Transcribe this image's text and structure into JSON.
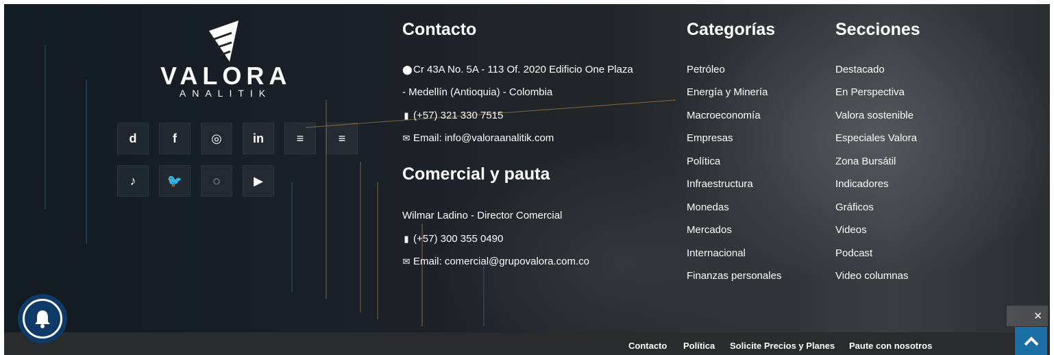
{
  "brand": {
    "name": "VALORA",
    "sub": "ANALITIK"
  },
  "social": [
    {
      "icon": "dailymotion-icon",
      "glyph": "d"
    },
    {
      "icon": "facebook-icon",
      "glyph": "f"
    },
    {
      "icon": "instagram-icon",
      "glyph": "◎"
    },
    {
      "icon": "linkedin-icon",
      "glyph": "in"
    },
    {
      "icon": "rss-icon",
      "glyph": "≡"
    },
    {
      "icon": "spotify-icon",
      "glyph": "≡"
    },
    {
      "icon": "tiktok-icon",
      "glyph": "♪"
    },
    {
      "icon": "twitter-icon",
      "glyph": "🐦"
    },
    {
      "icon": "whatsapp-icon",
      "glyph": "◌"
    },
    {
      "icon": "youtube-icon",
      "glyph": "▶"
    }
  ],
  "contact": {
    "title": "Contacto",
    "address1": "Cr 43A No. 5A - 113 Of. 2020 Edificio One Plaza",
    "address2": "- Medellín (Antioquia) - Colombia",
    "phone": "(+57) 321 330 7515",
    "email": "Email: info@valoraanalitik.com"
  },
  "commercial": {
    "title": "Comercial y pauta",
    "person": "Wilmar Ladino - Director Comercial",
    "phone": "(+57) 300 355 0490",
    "email": "Email: comercial@grupovalora.com.co"
  },
  "categories": {
    "title": "Categorías",
    "items": [
      "Petróleo",
      "Energía y Minería",
      "Macroeconomía",
      "Empresas",
      "Política",
      "Infraestructura",
      "Monedas",
      "Mercados",
      "Internacional",
      "Finanzas personales"
    ]
  },
  "sections": {
    "title": "Secciones",
    "items": [
      "Destacado",
      "En Perspectiva",
      "Valora sostenible",
      "Especiales Valora",
      "Zona Bursátil",
      "Indicadores",
      "Gráficos",
      "Videos",
      "Podcast",
      "Video columnas"
    ]
  },
  "bottom_links": [
    "Contacto",
    "Política",
    "Solicite Precios y Planes",
    "Paute con nosotros"
  ],
  "ad_close": "✕",
  "colors": {
    "accent": "#1a6fa5",
    "bell": "#0d3a66",
    "bar": "#2a2b2c"
  }
}
